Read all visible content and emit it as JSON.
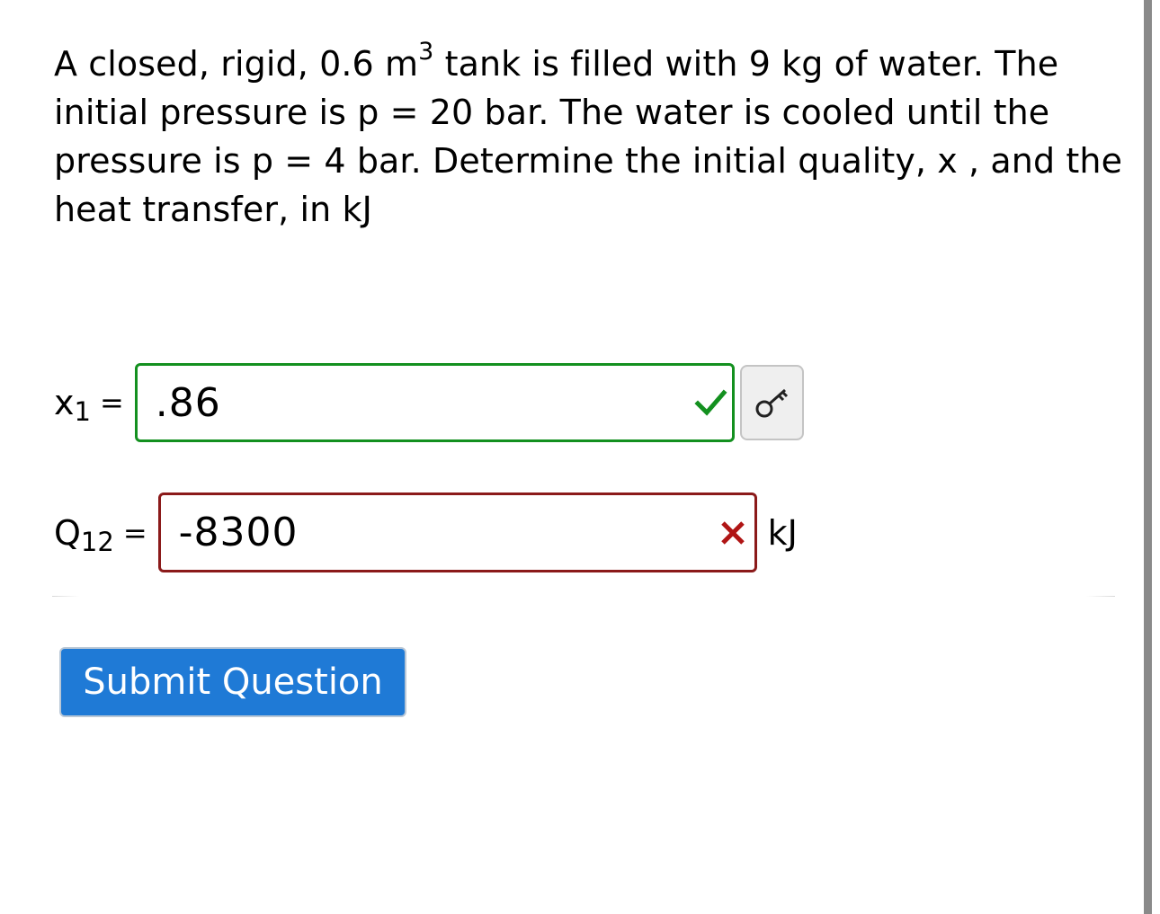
{
  "question": {
    "part1": "A closed, rigid, 0.6 m",
    "superscript": "3",
    "part2": " tank is filled with 9 kg of water. The initial pressure is p = 20 bar. The water is cooled until the pressure is p = 4 bar. Determine the initial quality, x , and the heat transfer, in kJ"
  },
  "answers": {
    "x1": {
      "label": "x",
      "subscript": "1",
      "equals": "=",
      "value": ".86",
      "status": "correct",
      "status_icon": "check-icon",
      "status_color": "#13901f"
    },
    "q12": {
      "label": "Q",
      "subscript": "12",
      "equals": "=",
      "value": "-8300",
      "status": "incorrect",
      "status_icon": "x-icon",
      "status_color": "#8b1a1a",
      "unit": "kJ"
    }
  },
  "key_button": {
    "icon": "key-icon"
  },
  "submit": {
    "label": "Submit Question",
    "color": "#1f7ad6"
  }
}
